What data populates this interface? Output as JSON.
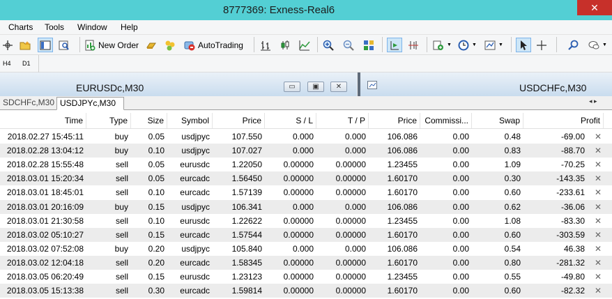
{
  "window": {
    "title": "8777369: Exness-Real6",
    "close_glyph": "✕"
  },
  "menu": [
    "Charts",
    "Tools",
    "Window",
    "Help"
  ],
  "toolbar": {
    "new_order_label": "New Order",
    "autotrading_label": "AutoTrading"
  },
  "timeframes": [
    "H4",
    "D1"
  ],
  "charts": [
    {
      "label": "EURUSDc,M30",
      "buttons": [
        "▭",
        "▣",
        "✕"
      ]
    },
    {
      "label": "USDCHFc,M30"
    }
  ],
  "tabs": {
    "inactive": "SDCHFc,M30",
    "active": "USDJPYc,M30",
    "nav": "◂  ▸"
  },
  "table": {
    "columns": [
      "Time",
      "Type",
      "Size",
      "Symbol",
      "Price",
      "S / L",
      "T / P",
      "Price",
      "Commissi...",
      "Swap",
      "Profit"
    ],
    "rows": [
      [
        "2018.02.27 15:45:11",
        "buy",
        "0.05",
        "usdjpyc",
        "107.550",
        "0.000",
        "0.000",
        "106.086",
        "0.00",
        "0.48",
        "-69.00"
      ],
      [
        "2018.02.28 13:04:12",
        "buy",
        "0.10",
        "usdjpyc",
        "107.027",
        "0.000",
        "0.000",
        "106.086",
        "0.00",
        "0.83",
        "-88.70"
      ],
      [
        "2018.02.28 15:55:48",
        "sell",
        "0.05",
        "eurusdc",
        "1.22050",
        "0.00000",
        "0.00000",
        "1.23455",
        "0.00",
        "1.09",
        "-70.25"
      ],
      [
        "2018.03.01 15:20:34",
        "sell",
        "0.05",
        "eurcadc",
        "1.56450",
        "0.00000",
        "0.00000",
        "1.60170",
        "0.00",
        "0.30",
        "-143.35"
      ],
      [
        "2018.03.01 18:45:01",
        "sell",
        "0.10",
        "eurcadc",
        "1.57139",
        "0.00000",
        "0.00000",
        "1.60170",
        "0.00",
        "0.60",
        "-233.61"
      ],
      [
        "2018.03.01 20:16:09",
        "buy",
        "0.15",
        "usdjpyc",
        "106.341",
        "0.000",
        "0.000",
        "106.086",
        "0.00",
        "0.62",
        "-36.06"
      ],
      [
        "2018.03.01 21:30:58",
        "sell",
        "0.10",
        "eurusdc",
        "1.22622",
        "0.00000",
        "0.00000",
        "1.23455",
        "0.00",
        "1.08",
        "-83.30"
      ],
      [
        "2018.03.02 05:10:27",
        "sell",
        "0.15",
        "eurcadc",
        "1.57544",
        "0.00000",
        "0.00000",
        "1.60170",
        "0.00",
        "0.60",
        "-303.59"
      ],
      [
        "2018.03.02 07:52:08",
        "buy",
        "0.20",
        "usdjpyc",
        "105.840",
        "0.000",
        "0.000",
        "106.086",
        "0.00",
        "0.54",
        "46.38"
      ],
      [
        "2018.03.02 12:04:18",
        "sell",
        "0.20",
        "eurcadc",
        "1.58345",
        "0.00000",
        "0.00000",
        "1.60170",
        "0.00",
        "0.80",
        "-281.32"
      ],
      [
        "2018.03.05 06:20:49",
        "sell",
        "0.15",
        "eurusdc",
        "1.23123",
        "0.00000",
        "0.00000",
        "1.23455",
        "0.00",
        "0.55",
        "-49.80"
      ],
      [
        "2018.03.05 15:13:38",
        "sell",
        "0.30",
        "eurcadc",
        "1.59814",
        "0.00000",
        "0.00000",
        "1.60170",
        "0.00",
        "0.60",
        "-82.32"
      ]
    ],
    "row_close_glyph": "✕"
  }
}
